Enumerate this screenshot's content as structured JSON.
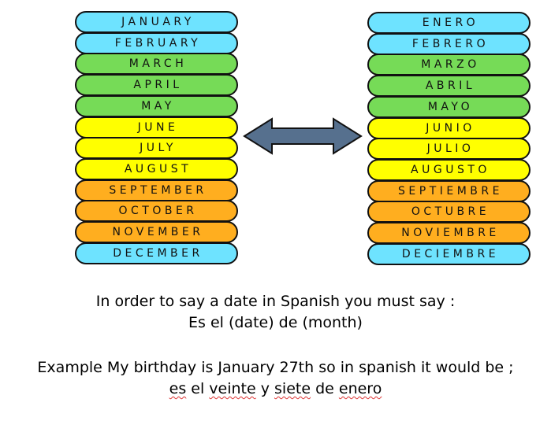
{
  "colors": {
    "blue": "#6ee3ff",
    "green": "#76db57",
    "yellow": "#ffff00",
    "orange": "#ffae1f",
    "arrow": "#56708e"
  },
  "english_months": [
    {
      "label": "JANUARY",
      "color": "blue"
    },
    {
      "label": "FEBRUARY",
      "color": "blue"
    },
    {
      "label": "MARCH",
      "color": "green"
    },
    {
      "label": "APRIL",
      "color": "green"
    },
    {
      "label": "MAY",
      "color": "green"
    },
    {
      "label": "JUNE",
      "color": "yellow"
    },
    {
      "label": "JULY",
      "color": "yellow"
    },
    {
      "label": "AUGUST",
      "color": "yellow"
    },
    {
      "label": "SEPTEMBER",
      "color": "orange"
    },
    {
      "label": "OCTOBER",
      "color": "orange"
    },
    {
      "label": "NOVEMBER",
      "color": "orange"
    },
    {
      "label": "DECEMBER",
      "color": "blue"
    }
  ],
  "spanish_months": [
    {
      "label": "ENERO",
      "color": "blue"
    },
    {
      "label": "FEBRERO",
      "color": "blue"
    },
    {
      "label": "MARZO",
      "color": "green"
    },
    {
      "label": "ABRIL",
      "color": "green"
    },
    {
      "label": "MAYO",
      "color": "green"
    },
    {
      "label": "JUNIO",
      "color": "yellow"
    },
    {
      "label": "JULIO",
      "color": "yellow"
    },
    {
      "label": "AUGUSTO",
      "color": "yellow"
    },
    {
      "label": "SEPTIEMBRE",
      "color": "orange"
    },
    {
      "label": "OCTUBRE",
      "color": "orange"
    },
    {
      "label": "NOVIEMBRE",
      "color": "orange"
    },
    {
      "label": "DECIEMBRE",
      "color": "blue"
    }
  ],
  "arrow_icon": "double-headed-arrow",
  "instructions": {
    "line1": "In order to say a date in Spanish you must  say :",
    "line2": "Es el (date) de (month)"
  },
  "example": {
    "line1": "Example My birthday is January 27th so in spanish it would be ;",
    "words": [
      "es",
      " el ",
      "veinte",
      " y ",
      "siete",
      " de ",
      "enero"
    ],
    "misspelled": [
      true,
      false,
      true,
      false,
      true,
      false,
      true
    ]
  }
}
